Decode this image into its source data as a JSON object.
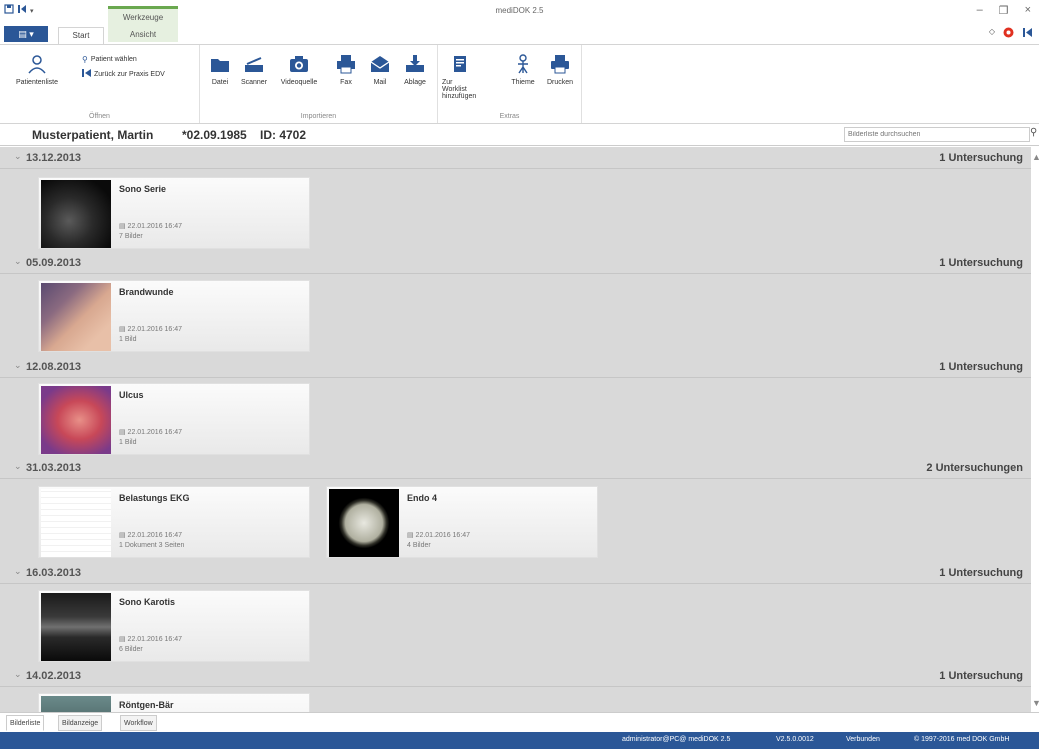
{
  "app": {
    "title": "mediDOK 2.5",
    "contextual_tab_header": "Werkzeuge",
    "file_button": "▤ ▾"
  },
  "window_controls": {
    "minimize": "–",
    "restore": "❐",
    "close": "×"
  },
  "tabs": {
    "start": "Start",
    "ansicht": "Ansicht"
  },
  "ribbon": {
    "groups": {
      "oeffnen": {
        "label": "Öffnen",
        "patientenliste": "Patientenliste",
        "patient_waehlen": "Patient wählen",
        "zurueck": "Zurück zur Praxis EDV"
      },
      "importieren": {
        "label": "Importieren",
        "datei": "Datei",
        "scanner": "Scanner",
        "videoquelle": "Videoquelle",
        "fax": "Fax",
        "mail": "Mail",
        "ablage": "Ablage"
      },
      "extras": {
        "label": "Extras",
        "zur_worklist": "Zur Worklist hinzufügen",
        "thieme": "Thieme",
        "drucken": "Drucken"
      }
    }
  },
  "patient": {
    "name": "Musterpatient, Martin",
    "dob": "*02.09.1985",
    "id": "ID: 4702"
  },
  "search": {
    "placeholder": "Bilderliste durchsuchen"
  },
  "groups": [
    {
      "date": "13.12.2013",
      "count": "1 Untersuchung",
      "cards": [
        {
          "title": "Sono Serie",
          "date": "▤ 22.01.2016 16:47",
          "info": "7 Bilder",
          "thumb": "sono"
        }
      ]
    },
    {
      "date": "05.09.2013",
      "count": "1 Untersuchung",
      "cards": [
        {
          "title": "Brandwunde",
          "date": "▤ 22.01.2016 16:47",
          "info": "1 Bild",
          "thumb": "skin"
        }
      ]
    },
    {
      "date": "12.08.2013",
      "count": "1 Untersuchung",
      "cards": [
        {
          "title": "Ulcus",
          "date": "▤ 22.01.2016 16:47",
          "info": "1 Bild",
          "thumb": "ulcus"
        }
      ]
    },
    {
      "date": "31.03.2013",
      "count": "2 Untersuchungen",
      "cards": [
        {
          "title": "Belastungs EKG",
          "date": "▤ 22.01.2016 16:47",
          "info": "1 Dokument 3 Seiten",
          "thumb": "ekg"
        },
        {
          "title": "Endo 4",
          "date": "▤ 22.01.2016 16:47",
          "info": "4 Bilder",
          "thumb": "endo"
        }
      ]
    },
    {
      "date": "16.03.2013",
      "count": "1 Untersuchung",
      "cards": [
        {
          "title": "Sono Karotis",
          "date": "▤ 22.01.2016 16:47",
          "info": "6 Bilder",
          "thumb": "sono2"
        }
      ]
    },
    {
      "date": "14.02.2013",
      "count": "1 Untersuchung",
      "cards": [
        {
          "title": "Röntgen-Bär",
          "date": "",
          "info": "",
          "thumb": "xray"
        }
      ]
    }
  ],
  "bottom_tabs": [
    "Bilderliste",
    "Bildanzeige",
    "Workflow"
  ],
  "status": {
    "user": "administrator@PC@ mediDOK 2.5",
    "version": "V2.5.0.0012",
    "connection": "Verbunden",
    "copyright": "© 1997-2016 med DOK GmbH"
  }
}
